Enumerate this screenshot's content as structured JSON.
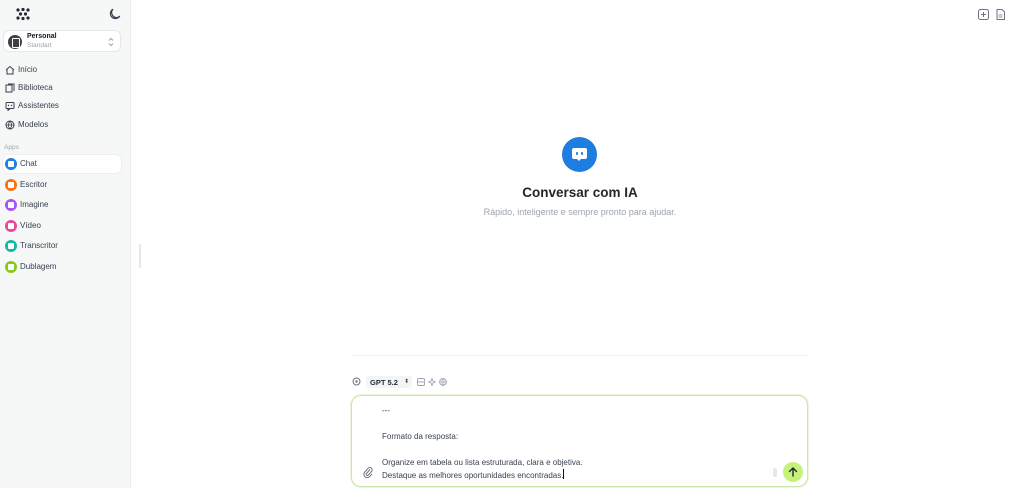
{
  "sidebar": {
    "workspace": {
      "name": "Personal",
      "plan": "Standart"
    },
    "nav": [
      {
        "label": "Início",
        "icon": "home-icon"
      },
      {
        "label": "Biblioteca",
        "icon": "library-icon"
      },
      {
        "label": "Assistentes",
        "icon": "assistant-icon"
      },
      {
        "label": "Modelos",
        "icon": "globe-icon"
      }
    ],
    "apps_label": "Apps",
    "apps": [
      {
        "label": "Chat",
        "icon": "chat-icon",
        "color": "#1d7de0"
      },
      {
        "label": "Escritor",
        "icon": "pen-icon",
        "color": "#f97316"
      },
      {
        "label": "Imagine",
        "icon": "image-icon",
        "color": "#a855f7"
      },
      {
        "label": "Vídeo",
        "icon": "play-icon",
        "color": "#ec4899"
      },
      {
        "label": "Transcritor",
        "icon": "headphones-icon",
        "color": "#14b8a6"
      },
      {
        "label": "Dublagem",
        "icon": "megaphone-icon",
        "color": "#84cc16"
      }
    ]
  },
  "hero": {
    "title": "Conversar com IA",
    "subtitle": "Rápido, inteligente e sempre pronto para ajudar."
  },
  "composer": {
    "model": "GPT 5.2",
    "lines": [
      "---",
      "",
      "Formato da resposta:",
      "",
      "Organize em tabela ou lista estruturada, clara e objetiva.",
      "Destaque as melhores oportunidades encontradas."
    ]
  }
}
